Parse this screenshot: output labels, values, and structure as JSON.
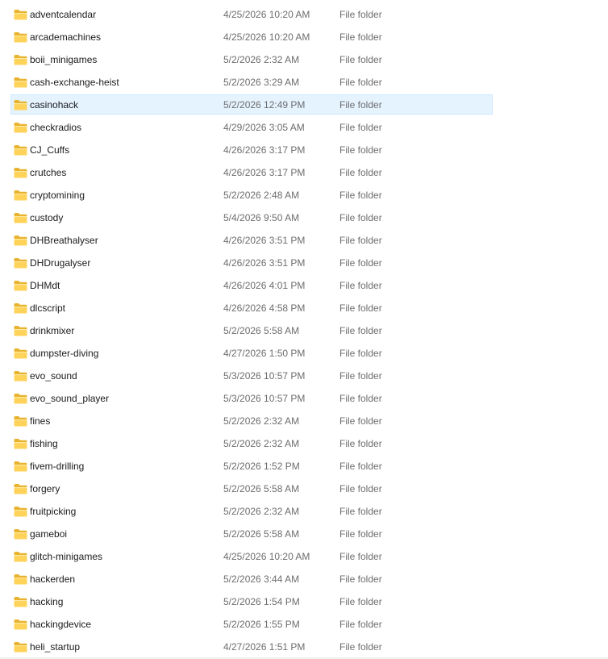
{
  "colors": {
    "selection_fill": "#e5f3ff",
    "selection_border": "#cce8ff",
    "folder_yellow": "#ffd35a",
    "secondary_text": "#6d6d6d"
  },
  "icon": "folder-icon",
  "files": [
    {
      "name": "adventcalendar",
      "date": "4/25/2026 10:20 AM",
      "type": "File folder"
    },
    {
      "name": "arcademachines",
      "date": "4/25/2026 10:20 AM",
      "type": "File folder"
    },
    {
      "name": "boii_minigames",
      "date": "5/2/2026 2:32 AM",
      "type": "File folder"
    },
    {
      "name": "cash-exchange-heist",
      "date": "5/2/2026 3:29 AM",
      "type": "File folder"
    },
    {
      "name": "casinohack",
      "date": "5/2/2026 12:49 PM",
      "type": "File folder",
      "selected": true
    },
    {
      "name": "checkradios",
      "date": "4/29/2026 3:05 AM",
      "type": "File folder"
    },
    {
      "name": "CJ_Cuffs",
      "date": "4/26/2026 3:17 PM",
      "type": "File folder"
    },
    {
      "name": "crutches",
      "date": "4/26/2026 3:17 PM",
      "type": "File folder"
    },
    {
      "name": "cryptomining",
      "date": "5/2/2026 2:48 AM",
      "type": "File folder"
    },
    {
      "name": "custody",
      "date": "5/4/2026 9:50 AM",
      "type": "File folder"
    },
    {
      "name": "DHBreathalyser",
      "date": "4/26/2026 3:51 PM",
      "type": "File folder"
    },
    {
      "name": "DHDrugalyser",
      "date": "4/26/2026 3:51 PM",
      "type": "File folder"
    },
    {
      "name": "DHMdt",
      "date": "4/26/2026 4:01 PM",
      "type": "File folder"
    },
    {
      "name": "dlcscript",
      "date": "4/26/2026 4:58 PM",
      "type": "File folder"
    },
    {
      "name": "drinkmixer",
      "date": "5/2/2026 5:58 AM",
      "type": "File folder"
    },
    {
      "name": "dumpster-diving",
      "date": "4/27/2026 1:50 PM",
      "type": "File folder"
    },
    {
      "name": "evo_sound",
      "date": "5/3/2026 10:57 PM",
      "type": "File folder"
    },
    {
      "name": "evo_sound_player",
      "date": "5/3/2026 10:57 PM",
      "type": "File folder"
    },
    {
      "name": "fines",
      "date": "5/2/2026 2:32 AM",
      "type": "File folder"
    },
    {
      "name": "fishing",
      "date": "5/2/2026 2:32 AM",
      "type": "File folder"
    },
    {
      "name": "fivem-drilling",
      "date": "5/2/2026 1:52 PM",
      "type": "File folder"
    },
    {
      "name": "forgery",
      "date": "5/2/2026 5:58 AM",
      "type": "File folder"
    },
    {
      "name": "fruitpicking",
      "date": "5/2/2026 2:32 AM",
      "type": "File folder"
    },
    {
      "name": "gameboi",
      "date": "5/2/2026 5:58 AM",
      "type": "File folder"
    },
    {
      "name": "glitch-minigames",
      "date": "4/25/2026 10:20 AM",
      "type": "File folder"
    },
    {
      "name": "hackerden",
      "date": "5/2/2026 3:44 AM",
      "type": "File folder"
    },
    {
      "name": "hacking",
      "date": "5/2/2026 1:54 PM",
      "type": "File folder"
    },
    {
      "name": "hackingdevice",
      "date": "5/2/2026 1:55 PM",
      "type": "File folder"
    },
    {
      "name": "heli_startup",
      "date": "4/27/2026 1:51 PM",
      "type": "File folder"
    }
  ]
}
